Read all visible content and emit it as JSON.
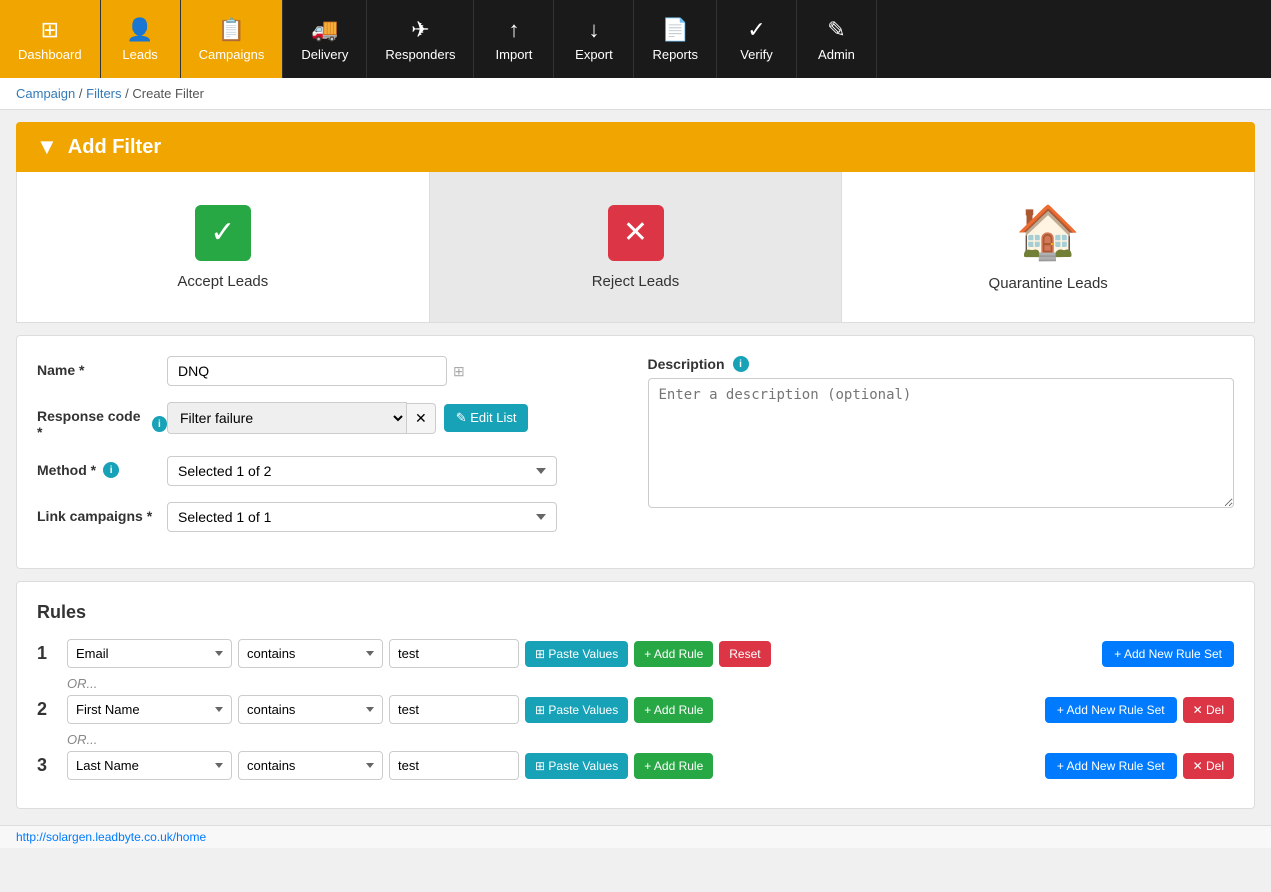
{
  "nav": {
    "items": [
      {
        "id": "dashboard",
        "label": "Dashboard",
        "icon": "⊞",
        "active": false
      },
      {
        "id": "leads",
        "label": "Leads",
        "icon": "👤",
        "active": true
      },
      {
        "id": "campaigns",
        "label": "Campaigns",
        "icon": "📋",
        "active": true
      },
      {
        "id": "delivery",
        "label": "Delivery",
        "icon": "🚚",
        "active": false
      },
      {
        "id": "responders",
        "label": "Responders",
        "icon": "✈",
        "active": false
      },
      {
        "id": "import",
        "label": "Import",
        "icon": "↑",
        "active": false
      },
      {
        "id": "export",
        "label": "Export",
        "icon": "↓",
        "active": false
      },
      {
        "id": "reports",
        "label": "Reports",
        "icon": "📄",
        "active": false
      },
      {
        "id": "verify",
        "label": "Verify",
        "icon": "✓",
        "active": false
      },
      {
        "id": "admin",
        "label": "Admin",
        "icon": "✎",
        "active": false
      }
    ]
  },
  "breadcrumb": {
    "parts": [
      "Campaign",
      "Filters",
      "Create Filter"
    ]
  },
  "page": {
    "title": "Add Filter",
    "filter_types": [
      {
        "id": "accept",
        "label": "Accept Leads",
        "selected": false
      },
      {
        "id": "reject",
        "label": "Reject Leads",
        "selected": true
      },
      {
        "id": "quarantine",
        "label": "Quarantine Leads",
        "selected": false
      }
    ]
  },
  "form": {
    "name_label": "Name *",
    "name_value": "DNQ",
    "response_code_label": "Response code *",
    "response_code_value": "Filter failure",
    "edit_list_label": "✎ Edit List",
    "method_label": "Method *",
    "method_value": "Selected 1 of 2",
    "link_campaigns_label": "Link campaigns *",
    "link_campaigns_value": "Selected 1 of 1",
    "description_label": "Description",
    "description_placeholder": "Enter a description (optional)"
  },
  "rules": {
    "title": "Rules",
    "rows": [
      {
        "number": "1",
        "field": "Email",
        "operator": "contains",
        "value": "test",
        "show_del": false
      },
      {
        "number": "2",
        "field": "First Name",
        "operator": "contains",
        "value": "test",
        "show_del": true
      },
      {
        "number": "3",
        "field": "Last Name",
        "operator": "contains",
        "value": "test",
        "show_del": true
      }
    ],
    "paste_label": "⊞ Paste Values",
    "add_rule_label": "+ Add Rule",
    "reset_label": "Reset",
    "add_rule_set_label": "+ Add New Rule Set",
    "del_label": "✕ Del",
    "or_label": "OR..."
  },
  "status_bar": {
    "url": "http://solargen.leadbyte.co.uk/home"
  },
  "colors": {
    "nav_active": "#f0a500",
    "nav_bg": "#1a1a1a",
    "accept_green": "#28a745",
    "reject_red": "#dc3545",
    "quarantine_orange": "#f0a500",
    "info_blue": "#17a2b8",
    "link_blue": "#007bff"
  }
}
